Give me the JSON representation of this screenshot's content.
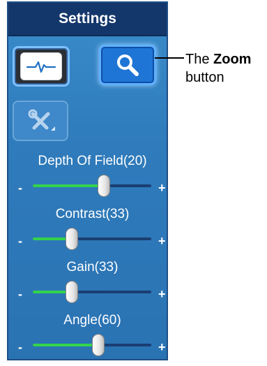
{
  "panel": {
    "title": "Settings",
    "buttons": {
      "signal_icon": "waveform-icon",
      "zoom_icon": "magnifier-icon",
      "tools_icon": "wrench-screwdriver-icon"
    },
    "sliders": [
      {
        "label": "Depth Of Field(20)",
        "minus": "-",
        "plus": "+",
        "value_fraction": 0.6
      },
      {
        "label": "Contrast(33)",
        "minus": "-",
        "plus": "+",
        "value_fraction": 0.33
      },
      {
        "label": "Gain(33)",
        "minus": "-",
        "plus": "+",
        "value_fraction": 0.33
      },
      {
        "label": "Angle(60)",
        "minus": "-",
        "plus": "+",
        "value_fraction": 0.55
      }
    ]
  },
  "callout": {
    "prefix": "The ",
    "bold": "Zoom",
    "suffix": "button"
  },
  "colors": {
    "panel_bg": "#2f7bbb",
    "header_bg": "#14376b",
    "slider_fill": "#34d34c",
    "slider_track": "#1a3e72",
    "zoom_button": "#1e75d5"
  }
}
